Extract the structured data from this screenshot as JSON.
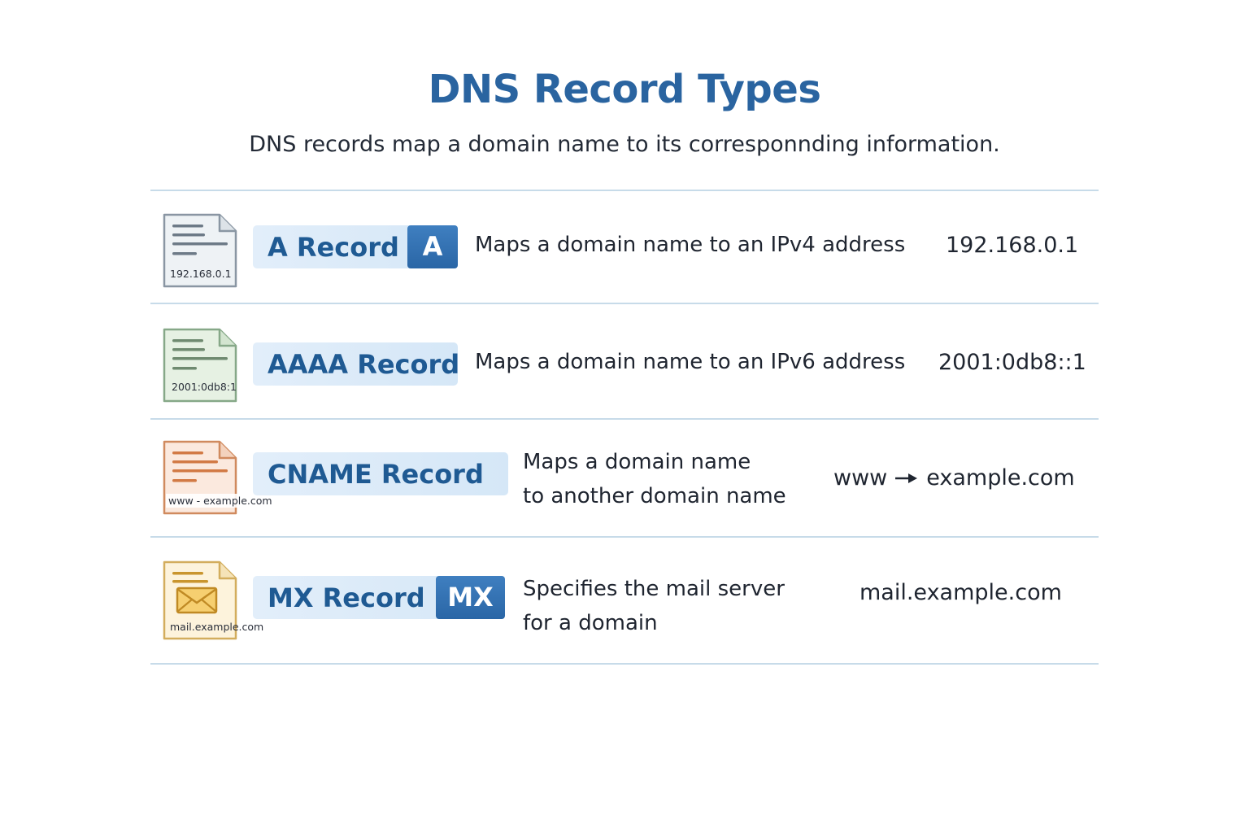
{
  "title": "DNS Record Types",
  "subtitle": "DNS records map a domain name to its corresponnding information.",
  "records": [
    {
      "name": "A Record",
      "badge": "A",
      "description": [
        "Maps a domain name to an IPv4 address"
      ],
      "value": "192.168.0.1",
      "file_caption": "192.168.0.1",
      "color": "#7f8c99"
    },
    {
      "name": "AAAA Record",
      "badge": "",
      "description": [
        "Maps a domain name to an IPv6 address"
      ],
      "value": "2001:0db8::1",
      "file_caption": "2001:0db8:1",
      "color": "#7fa383"
    },
    {
      "name": "CNAME Record",
      "badge": "",
      "description": [
        "Maps a domain name",
        "to another domain name"
      ],
      "value_from": "www",
      "value_to": "example.com",
      "file_caption": "www - example.com",
      "color": "#d0875a"
    },
    {
      "name": "MX Record",
      "badge": "MX",
      "description": [
        "Specifies the mail server",
        "for a domain"
      ],
      "value": "mail.example.com",
      "file_caption": "mail.example.com",
      "color": "#d4a843"
    }
  ]
}
